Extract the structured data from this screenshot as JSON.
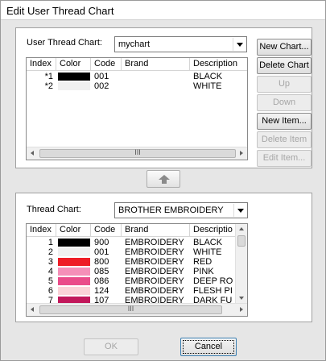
{
  "window": {
    "title": "Edit User Thread Chart"
  },
  "user_chart": {
    "label": "User Thread Chart:",
    "selected": "mychart",
    "columns": [
      "Index",
      "Color",
      "Code",
      "Brand",
      "Description"
    ],
    "rows": [
      {
        "index": "*1",
        "color": "#000000",
        "code": "001",
        "brand": "",
        "description": "BLACK"
      },
      {
        "index": "*2",
        "color": "#f0f0f0",
        "code": "002",
        "brand": "",
        "description": "WHITE"
      }
    ],
    "hscroll_thumb": "III"
  },
  "buttons": {
    "new_chart": "New Chart...",
    "delete_chart": "Delete Chart",
    "up": "Up",
    "down": "Down",
    "new_item": "New Item...",
    "delete_item": "Delete Item",
    "edit_item": "Edit Item...",
    "ok": "OK",
    "cancel": "Cancel"
  },
  "copy_button_icon": "up-arrow-icon",
  "thread_chart": {
    "label": "Thread Chart:",
    "selected": "BROTHER EMBROIDERY",
    "columns": [
      "Index",
      "Color",
      "Code",
      "Brand",
      "Descriptio"
    ],
    "rows": [
      {
        "index": "1",
        "color": "#000000",
        "code": "900",
        "brand": "EMBROIDERY",
        "description": "BLACK"
      },
      {
        "index": "2",
        "color": "#f0f0f0",
        "code": "001",
        "brand": "EMBROIDERY",
        "description": "WHITE"
      },
      {
        "index": "3",
        "color": "#ee1c25",
        "code": "800",
        "brand": "EMBROIDERY",
        "description": "RED"
      },
      {
        "index": "4",
        "color": "#f58fb8",
        "code": "085",
        "brand": "EMBROIDERY",
        "description": "PINK"
      },
      {
        "index": "5",
        "color": "#ea4c8a",
        "code": "086",
        "brand": "EMBROIDERY",
        "description": "DEEP RO"
      },
      {
        "index": "6",
        "color": "#fbd3d8",
        "code": "124",
        "brand": "EMBROIDERY",
        "description": "FLESH PI"
      },
      {
        "index": "7",
        "color": "#c2185b",
        "code": "107",
        "brand": "EMBROIDERY",
        "description": "DARK FU"
      }
    ],
    "hscroll_thumb": "III"
  }
}
